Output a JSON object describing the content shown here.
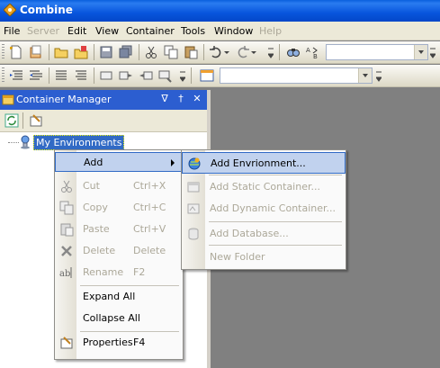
{
  "window": {
    "title": "Combine"
  },
  "menubar": {
    "items": [
      {
        "label": "File",
        "disabled": false
      },
      {
        "label": "Server",
        "disabled": true
      },
      {
        "label": "Edit",
        "disabled": false
      },
      {
        "label": "View",
        "disabled": false
      },
      {
        "label": "Container",
        "disabled": false
      },
      {
        "label": "Tools",
        "disabled": false
      },
      {
        "label": "Window",
        "disabled": false
      },
      {
        "label": "Help",
        "disabled": true
      }
    ]
  },
  "panel": {
    "title": "Container Manager",
    "pin_glyph": "∇",
    "pin2_glyph": "†",
    "close_glyph": "✕"
  },
  "tree": {
    "root_label": "My Environments"
  },
  "context_menu": {
    "items": [
      {
        "label": "Add",
        "shortcut": "",
        "disabled": false,
        "icon": "none"
      },
      {
        "label": "Cut",
        "shortcut": "Ctrl+X",
        "disabled": true,
        "icon": "scissors-icon"
      },
      {
        "label": "Copy",
        "shortcut": "Ctrl+C",
        "disabled": true,
        "icon": "copy-icon"
      },
      {
        "label": "Paste",
        "shortcut": "Ctrl+V",
        "disabled": true,
        "icon": "paste-icon"
      },
      {
        "label": "Delete",
        "shortcut": "Delete",
        "disabled": true,
        "icon": "delete-icon"
      },
      {
        "label": "Rename",
        "shortcut": "F2",
        "disabled": true,
        "icon": "rename-icon"
      },
      {
        "label": "Expand All",
        "shortcut": "",
        "disabled": false,
        "icon": "none"
      },
      {
        "label": "Collapse All",
        "shortcut": "",
        "disabled": false,
        "icon": "none"
      },
      {
        "label": "Properties",
        "shortcut": "F4",
        "disabled": false,
        "icon": "properties-icon"
      }
    ]
  },
  "submenu": {
    "items": [
      {
        "label": "Add Envrionment...",
        "disabled": false
      },
      {
        "label": "Add Static Container...",
        "disabled": true
      },
      {
        "label": "Add Dynamic Container...",
        "disabled": true
      },
      {
        "label": "Add Database...",
        "disabled": true
      },
      {
        "label": "New Folder",
        "disabled": true
      }
    ]
  },
  "colors": {
    "title_bar": "#0a5fdd",
    "panel_header": "#2c5ed0",
    "highlight": "#c1d2ee",
    "highlight_border": "#316ac5",
    "workspace": "#808080"
  }
}
